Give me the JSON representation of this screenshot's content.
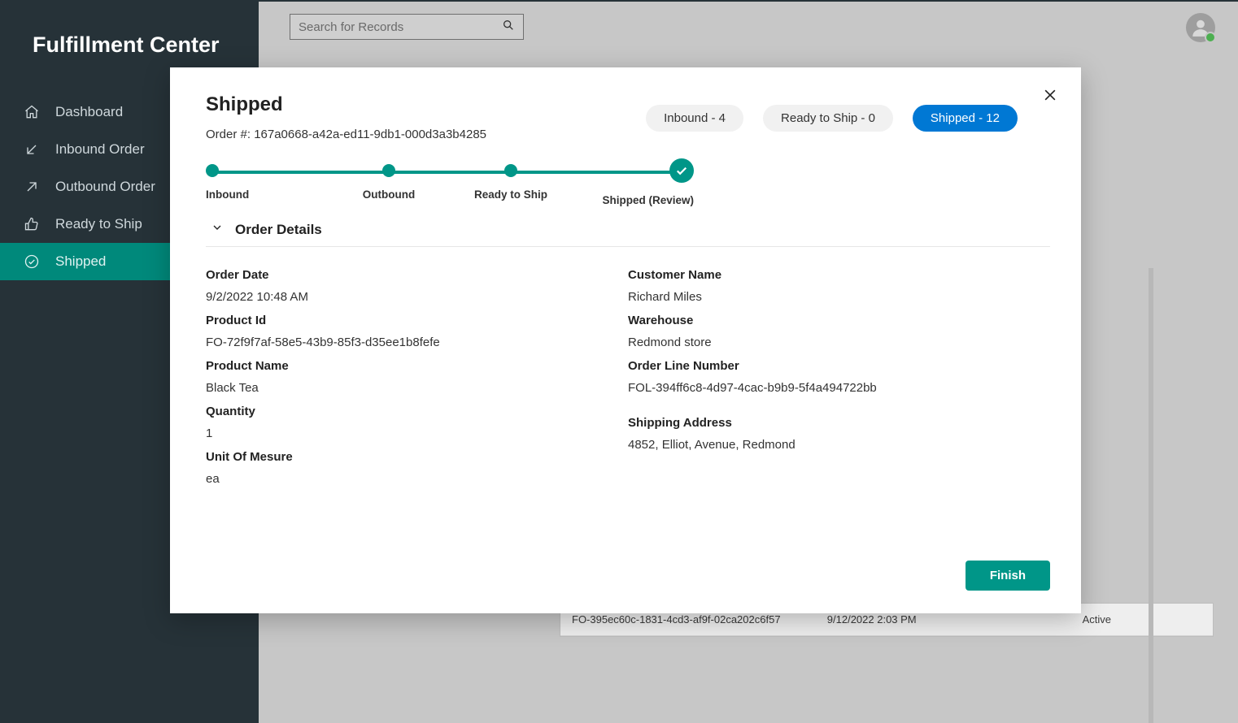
{
  "app_title": "Fulfillment Center",
  "search": {
    "placeholder": "Search for Records"
  },
  "sidebar": {
    "items": [
      {
        "label": "Dashboard"
      },
      {
        "label": "Inbound Order"
      },
      {
        "label": "Outbound Order"
      },
      {
        "label": "Ready to Ship"
      },
      {
        "label": "Shipped"
      }
    ]
  },
  "background_table": {
    "row": {
      "id": "FO-395ec60c-1831-4cd3-af9f-02ca202c6f57",
      "date": "9/12/2022 2:03 PM",
      "status": "Active"
    }
  },
  "modal": {
    "title": "Shipped",
    "order_num_label": "Order #: ",
    "order_num": "167a0668-a42a-ed11-9db1-000d3a3b4285",
    "pills": [
      {
        "label": "Inbound - 4"
      },
      {
        "label": "Ready to Ship - 0"
      },
      {
        "label": "Shipped - 12"
      }
    ],
    "steps": [
      {
        "label": "Inbound"
      },
      {
        "label": "Outbound"
      },
      {
        "label": "Ready to Ship"
      },
      {
        "label": "Shipped (Review)"
      }
    ],
    "section_title": "Order Details",
    "left": {
      "order_date_label": "Order Date",
      "order_date": "9/2/2022 10:48 AM",
      "product_id_label": "Product Id",
      "product_id": "FO-72f9f7af-58e5-43b9-85f3-d35ee1b8fefe",
      "product_name_label": "Product Name",
      "product_name": "Black Tea",
      "quantity_label": "Quantity",
      "quantity": "1",
      "uom_label": "Unit Of Mesure",
      "uom": "ea"
    },
    "right": {
      "customer_label": "Customer Name",
      "customer": "Richard Miles",
      "warehouse_label": "Warehouse",
      "warehouse": "Redmond store",
      "line_label": "Order Line Number",
      "line": "FOL-394ff6c8-4d97-4cac-b9b9-5f4a494722bb",
      "ship_label": "Shipping Address",
      "ship": "4852, Elliot, Avenue, Redmond"
    },
    "finish": "Finish"
  }
}
